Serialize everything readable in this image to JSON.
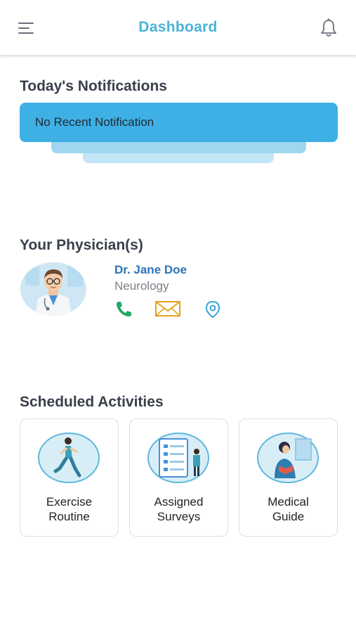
{
  "header": {
    "title": "Dashboard",
    "menu_icon": "hamburger-menu-icon",
    "bell_icon": "bell-icon"
  },
  "notifications": {
    "title": "Today's Notifications",
    "message": "No Recent Notification"
  },
  "physicians": {
    "title": "Your Physician(s)",
    "items": [
      {
        "name": "Dr. Jane Doe",
        "specialty": "Neurology",
        "actions": [
          "phone-icon",
          "mail-icon",
          "location-pin-icon"
        ]
      }
    ]
  },
  "activities": {
    "title": "Scheduled Activities",
    "items": [
      {
        "line1": "Exercise",
        "line2": "Routine"
      },
      {
        "line1": "Assigned",
        "line2": "Surveys"
      },
      {
        "line1": "Medical",
        "line2": "Guide"
      }
    ]
  },
  "colors": {
    "accent": "#4ab3d8",
    "notification_bg": "#3fb0e6",
    "physician_name": "#2b74b8",
    "phone": "#1fa866",
    "mail": "#e3a21a",
    "location": "#3aa3d6"
  }
}
